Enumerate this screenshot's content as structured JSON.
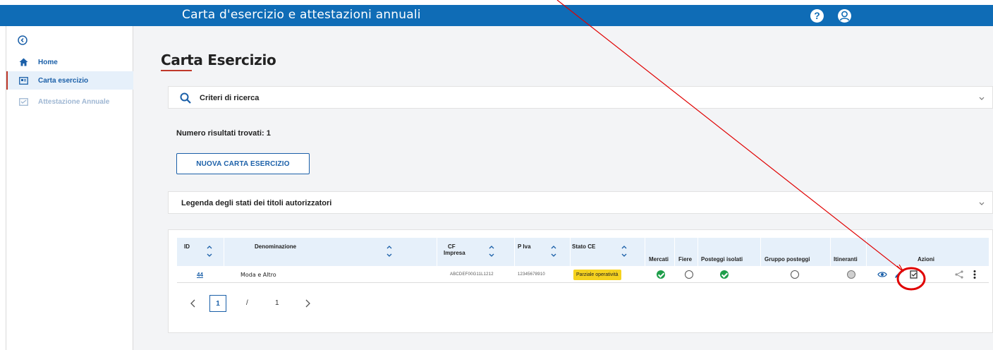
{
  "app": {
    "title": "Carta d'esercizio e attestazioni annuali",
    "help_label": "?",
    "accent": "#0f6cb6"
  },
  "sidebar": {
    "items": [
      {
        "label": "Home",
        "icon": "home-icon"
      },
      {
        "label": "Carta esercizio",
        "icon": "id-card-icon",
        "active": true
      },
      {
        "label": "Attestazione Annuale",
        "icon": "attestation-icon"
      }
    ]
  },
  "main": {
    "title": "Carta Esercizio",
    "search_label": "Criteri di ricerca",
    "results_label": "Numero risultati trovati: 1",
    "new_button": "NUOVA CARTA ESERCIZIO",
    "legend_label": "Legenda degli stati dei titoli autorizzatori"
  },
  "table": {
    "headers": {
      "id": "ID",
      "denominazione": "Denominazione",
      "cf_line1": "CF",
      "cf_line2": "Impresa",
      "piva": "P Iva",
      "stato": "Stato CE",
      "mercati": "Mercati",
      "fiere": "Fiere",
      "posteggi": "Posteggi isolati",
      "gruppo": "Gruppo posteggi",
      "itineranti": "Itineranti",
      "azioni": "Azioni"
    },
    "rows": [
      {
        "id": "44",
        "denominazione": "Moda e Altro",
        "cf": "ABCDEF00G11L1212",
        "piva": "12345678910",
        "stato": "Parziale operatività",
        "mercati": "ok",
        "fiere": "empty",
        "posteggi": "ok",
        "gruppo": "empty",
        "itineranti": "grey"
      }
    ]
  },
  "pagination": {
    "current": "1",
    "separator": "/",
    "total": "1"
  },
  "colors": {
    "primary": "#1a5fa8",
    "badge": "#f5d21f",
    "ok": "#1e9e4a",
    "annotation": "#e00000"
  }
}
